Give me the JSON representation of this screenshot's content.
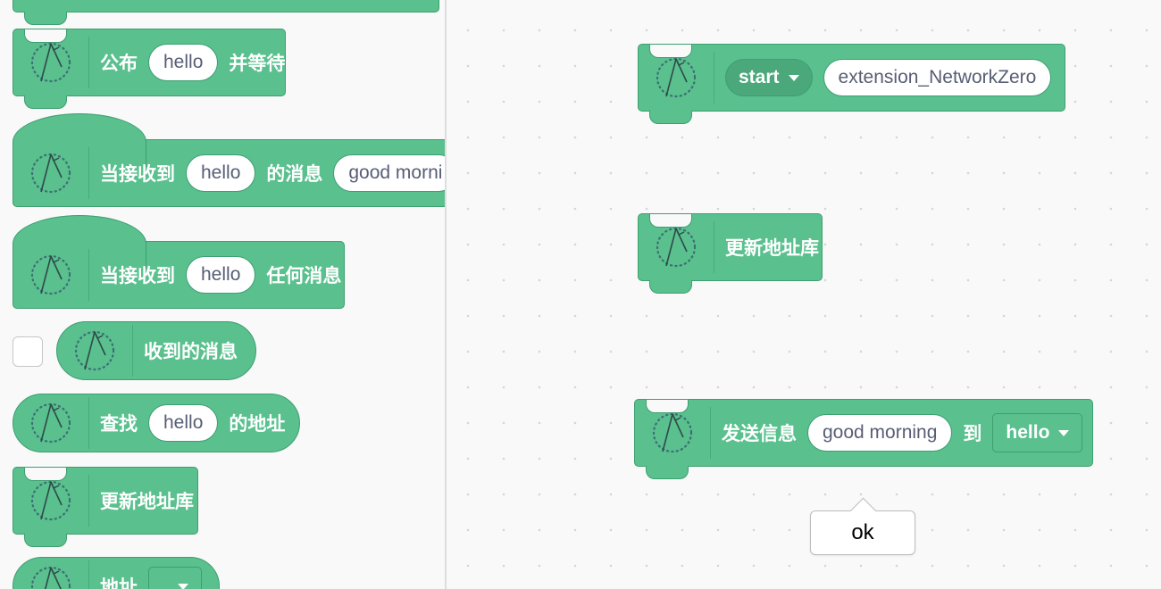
{
  "palette": {
    "publish_wait": {
      "prefix": "公布",
      "arg": "hello",
      "suffix": "并等待"
    },
    "when_receive_msg": {
      "prefix": "当接收到",
      "arg": "hello",
      "mid": "的消息",
      "arg2": "good morni"
    },
    "when_receive_any": {
      "prefix": "当接收到",
      "arg": "hello",
      "suffix": "任何消息"
    },
    "received_msg": {
      "label": "收到的消息"
    },
    "find_address": {
      "prefix": "查找",
      "arg": "hello",
      "suffix": "的地址"
    },
    "update_db": {
      "label": "更新地址库"
    },
    "address": {
      "label": "地址"
    }
  },
  "workspace": {
    "start_block": {
      "dropdown": "start",
      "arg": "extension_NetworkZero"
    },
    "update_db": {
      "label": "更新地址库"
    },
    "send_block": {
      "prefix": "发送信息",
      "arg": "good morning",
      "mid": "到",
      "dropdown": "hello"
    },
    "tooltip": {
      "text": "ok"
    }
  },
  "colors": {
    "block": "#59c08e",
    "block_border": "#3e9f70",
    "pill_text": "#575e75"
  },
  "icons": {
    "extension_icon": "network-zero-icon",
    "dropdown_caret": "chevron-down-icon"
  }
}
